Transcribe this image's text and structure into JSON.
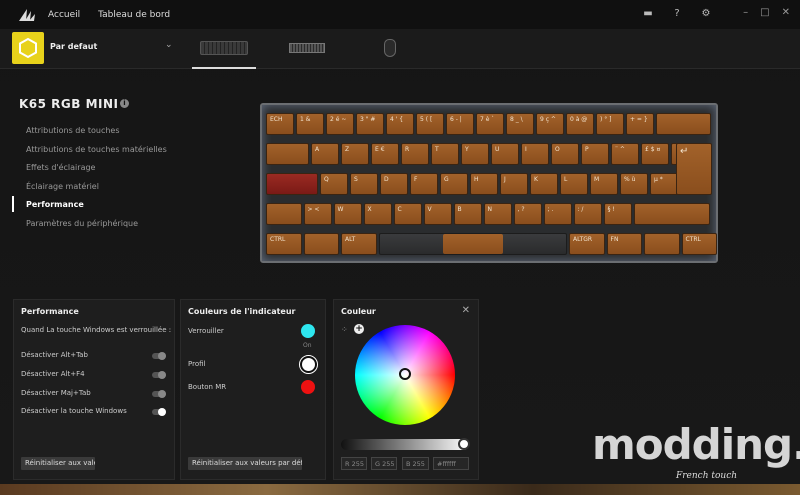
{
  "nav": {
    "home": "Accueil",
    "dashboard": "Tableau de bord"
  },
  "profile": {
    "name": "Par defaut",
    "color": "#e8d21b"
  },
  "device": {
    "title": "K65 RGB MINI"
  },
  "menu": [
    "Attributions de touches",
    "Attributions de touches matérielles",
    "Effets d'éclairage",
    "Éclairage matériel",
    "Performance",
    "Paramètres du périphérique"
  ],
  "keyboard": {
    "row1": [
      "ECH",
      "1 &",
      "2 é ~",
      "3 \" #",
      "4 ' {",
      "5 ( [",
      "6 - |",
      "7 è `",
      "8 _ \\",
      "9 ç ^",
      "0 à @",
      ") ° ]",
      "+ = }",
      ""
    ],
    "row2": [
      "",
      "A",
      "Z",
      "E €",
      "R",
      "T",
      "Y",
      "U",
      "I",
      "O",
      "P",
      "¨ ^",
      "£ $ ¤",
      ""
    ],
    "row3": [
      "",
      "Q",
      "S",
      "D",
      "F",
      "G",
      "H",
      "J",
      "K",
      "L",
      "M",
      "% ù",
      "µ *"
    ],
    "row4": [
      "",
      "> <",
      "W",
      "X",
      "C",
      "V",
      "B",
      "N",
      ", ?",
      "; .",
      ": /",
      "§ !",
      ""
    ],
    "row5": [
      "CTRL",
      "",
      "ALT",
      "",
      "ALTGR",
      "FN",
      "",
      "CTRL"
    ]
  },
  "performance": {
    "title": "Performance",
    "subtitle": "Quand  La touche Windows est verrouillée :",
    "options": [
      {
        "label": "Désactiver Alt+Tab",
        "on": false
      },
      {
        "label": "Désactiver Alt+F4",
        "on": false
      },
      {
        "label": "Désactiver Maj+Tab",
        "on": false
      },
      {
        "label": "Désactiver la touche Windows",
        "on": true
      }
    ],
    "reset": "Réinitialiser aux vale..."
  },
  "indicator": {
    "title": "Couleurs de l'indicateur",
    "lock": {
      "label": "Verrouiller",
      "state": "On",
      "color": "#2ee6ef"
    },
    "profile": {
      "label": "Profil",
      "color": "#ffffff"
    },
    "mr": {
      "label": "Bouton MR",
      "color": "#ee1111"
    },
    "reset": "Réinitialiser aux valeurs par défaut"
  },
  "color": {
    "title": "Couleur",
    "r": "R 255",
    "g": "G 255",
    "b": "B 255",
    "hex": "#ffffff"
  },
  "watermark": {
    "main": "modding.fr",
    "sub": "French touch"
  }
}
